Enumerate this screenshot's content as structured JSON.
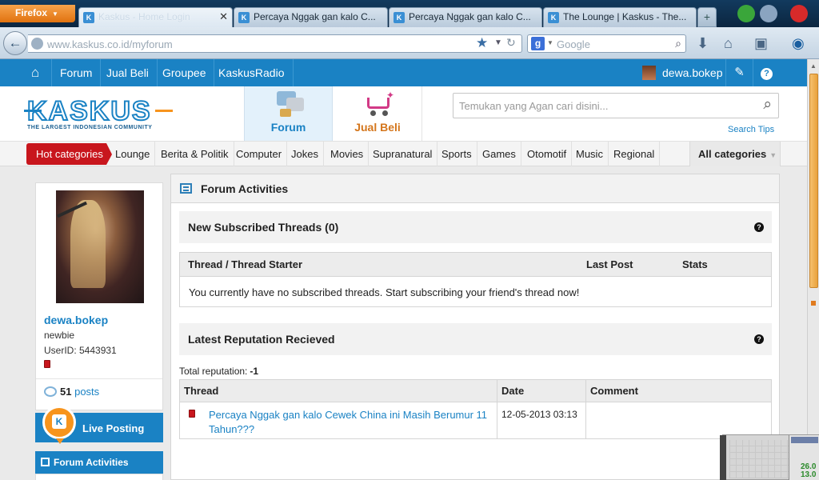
{
  "browser": {
    "menu_button": "Firefox",
    "tabs": [
      {
        "label": "Kaskus - Home Login"
      },
      {
        "label": "Percaya Nggak gan kalo C..."
      },
      {
        "label": "Percaya Nggak gan kalo C..."
      },
      {
        "label": "The Lounge | Kaskus - The..."
      }
    ],
    "new_tab": "+",
    "url": "www.kaskus.co.id/myforum",
    "search_placeholder": "Google",
    "search_engine_letter": "g"
  },
  "topmenu": {
    "items": [
      "Forum",
      "Jual Beli",
      "Groupee",
      "KaskusRadio"
    ],
    "username": "dewa.bokep"
  },
  "header": {
    "logo_text": "KASKUS",
    "logo_tagline": "THE LARGEST INDONESIAN COMMUNITY",
    "forum_label": "Forum",
    "jualbeli_label": "Jual Beli",
    "search_placeholder": "Temukan yang Agan cari disini...",
    "search_tips": "Search Tips"
  },
  "categories": {
    "hot": "Hot categories",
    "items": [
      "Lounge",
      "Berita & Politik",
      "Computer",
      "Jokes",
      "Movies",
      "Supranatural",
      "Sports",
      "Games",
      "Otomotif",
      "Music",
      "Regional"
    ],
    "all": "All categories"
  },
  "profile": {
    "name": "dewa.bokep",
    "rank": "newbie",
    "user_id": "UserID: 5443931",
    "posts_count": "51",
    "posts_label": "posts"
  },
  "sidebar": {
    "live_posting": "Live Posting",
    "forum_activities": "Forum Activities"
  },
  "main": {
    "title": "Forum Activities",
    "subscribed": {
      "title": "New Subscribed Threads (0)",
      "columns": [
        "Thread / Thread Starter",
        "Last Post",
        "Stats"
      ],
      "empty_message": "You currently have no subscribed threads. Start subscribing your friend's thread now!"
    },
    "reputation": {
      "title": "Latest Reputation Recieved",
      "total_label": "Total reputation:",
      "total_value": "-1",
      "columns": [
        "Thread",
        "Date",
        "Comment"
      ],
      "rows": [
        {
          "thread": "Percaya Nggak gan kalo Cewek China ini Masih Berumur 11 Tahun???",
          "date": "12-05-2013 03:13",
          "comment": ""
        }
      ]
    }
  },
  "widget": {
    "value_1": "26.0",
    "value_2": "13.0"
  },
  "colors": {
    "kaskus_blue": "#1a82c4",
    "hot_red": "#c8161d",
    "jualbeli_orange": "#d4761c"
  }
}
